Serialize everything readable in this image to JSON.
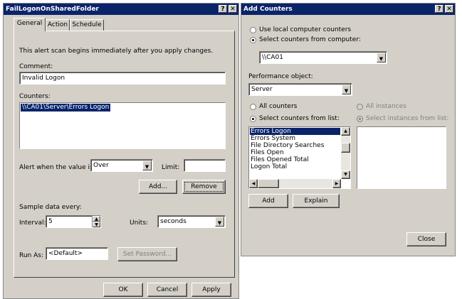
{
  "left_dialog": {
    "title": "FailLogonOnSharedFolder",
    "help_btn": "?",
    "close_btn": "✕",
    "tabs": [
      "General",
      "Action",
      "Schedule"
    ],
    "intro": "This alert scan begins immediately after you apply changes.",
    "comment_label": "Comment:",
    "comment_value": "Invalid Logon",
    "counters_label": "Counters:",
    "counters_list": [
      "\\\\CA01\\Server\\Errors Logon"
    ],
    "alert_label": "Alert when the value is:",
    "alert_value": "Over",
    "limit_label": "Limit:",
    "limit_value": "",
    "add_btn": "Add...",
    "remove_btn": "Remove",
    "sample_label": "Sample data every:",
    "interval_label": "Interval:",
    "interval_value": "5",
    "units_label": "Units:",
    "units_value": "seconds",
    "runas_label": "Run As:",
    "runas_value": "<Default>",
    "setpw_btn": "Set Password...",
    "ok_btn": "OK",
    "cancel_btn": "Cancel",
    "apply_btn": "Apply"
  },
  "right_dialog": {
    "title": "Add Counters",
    "help_btn": "?",
    "close_btn": "✕",
    "use_local": "Use local computer counters",
    "select_from_computer": "Select counters from computer:",
    "computer_value": "\\\\CA01",
    "perf_object_label": "Performance object:",
    "perf_object_value": "Server",
    "all_counters": "All counters",
    "select_counters_list": "Select counters from list:",
    "all_instances": "All instances",
    "select_instances": "Select instances from list:",
    "counter_items": [
      "Errors Logon",
      "Errors System",
      "File Directory Searches",
      "Files Open",
      "Files Opened Total",
      "Logon Total"
    ],
    "add_btn": "Add",
    "explain_btn": "Explain",
    "close_btn_label": "Close"
  },
  "colors": {
    "titlebar": "#0a246a",
    "dialog_bg": "#d4d0c8"
  }
}
